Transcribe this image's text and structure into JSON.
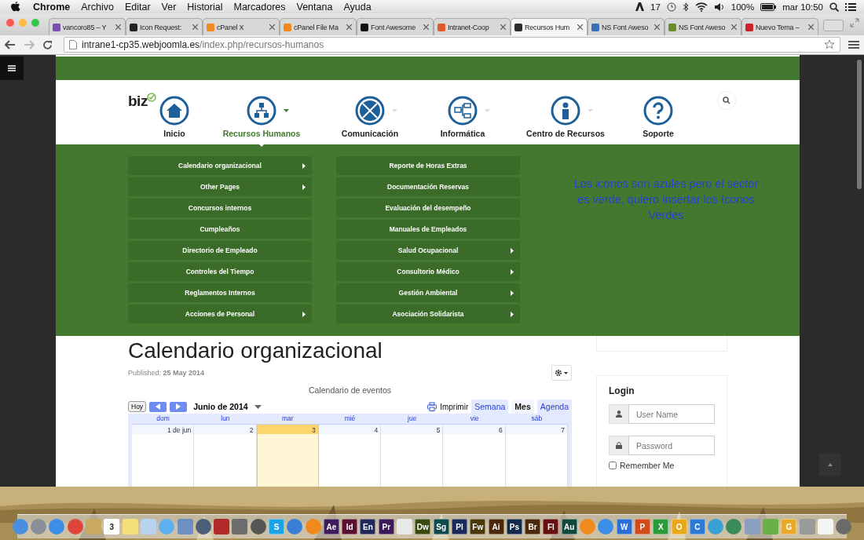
{
  "menubar": {
    "app": "Chrome",
    "items": [
      "Archivo",
      "Editar",
      "Ver",
      "Historial",
      "Marcadores",
      "Ventana",
      "Ayuda"
    ],
    "adobe_count": "17",
    "battery": "100%",
    "clock": "mar 10:50"
  },
  "tabs": [
    {
      "label": "vancoro85 – Y",
      "selected": false,
      "color": "#7b4fb0"
    },
    {
      "label": "Icon Request:",
      "selected": false,
      "color": "#222222"
    },
    {
      "label": "cPanel X",
      "selected": false,
      "color": "#f08a1c"
    },
    {
      "label": "cPanel File Ma",
      "selected": false,
      "color": "#f08a1c"
    },
    {
      "label": "Font Awesome",
      "selected": false,
      "color": "#111111"
    },
    {
      "label": "Intranet-Coop",
      "selected": false,
      "color": "#e05a2a"
    },
    {
      "label": "Recursos Hum",
      "selected": true,
      "color": "#2b2b2b"
    },
    {
      "label": "NS Font Aweso",
      "selected": false,
      "color": "#3b6fb6"
    },
    {
      "label": "NS Font Aweso",
      "selected": false,
      "color": "#6a8b2a"
    },
    {
      "label": "Nuevo Tema –",
      "selected": false,
      "color": "#d0202a"
    }
  ],
  "address": {
    "host": "intrane1-cp35.webjoomla.es",
    "path": "/index.php/recursos-humanos"
  },
  "site": {
    "logo": "biz",
    "nav": [
      {
        "label": "Inicio",
        "selected": false,
        "caret": false
      },
      {
        "label": "Recursos Humanos",
        "selected": true,
        "caret": true
      },
      {
        "label": "Comunicación",
        "selected": false,
        "caret": true
      },
      {
        "label": "Informática",
        "selected": false,
        "caret": true
      },
      {
        "label": "Centro de Recursos",
        "selected": false,
        "caret": true
      },
      {
        "label": "Soporte",
        "selected": false,
        "caret": false
      }
    ],
    "menu_left": [
      {
        "label": "Calendario organizacional",
        "submenu": true
      },
      {
        "label": "Other Pages",
        "submenu": true
      },
      {
        "label": "Concursos internos",
        "submenu": false
      },
      {
        "label": "Cumpleaños",
        "submenu": false
      },
      {
        "label": "Directorio de Empleado",
        "submenu": false
      },
      {
        "label": "Controles del Tiempo",
        "submenu": false
      },
      {
        "label": "Reglamentos Internos",
        "submenu": false
      },
      {
        "label": "Acciones de Personal",
        "submenu": true
      }
    ],
    "menu_right": [
      {
        "label": "Reporte de Horas Extras",
        "submenu": false
      },
      {
        "label": "Documentación Reservas",
        "submenu": false
      },
      {
        "label": "Evaluación del desempeño",
        "submenu": false
      },
      {
        "label": "Manuales de Empleados",
        "submenu": false
      },
      {
        "label": "Salud Ocupacional",
        "submenu": true
      },
      {
        "label": "Consultorio Médico",
        "submenu": true
      },
      {
        "label": "Gestión Ambiental",
        "submenu": true
      },
      {
        "label": "Asociación Solidarista",
        "submenu": true
      }
    ],
    "note": "Los iconos son azules pero el sector es verde, quiero insertar los Iconos Verdes",
    "title": "Calendario organizacional",
    "published": "Published: **25 May 2014**",
    "calendar": {
      "caption": "Calendario de eventos",
      "today_button": "Hoy",
      "month": "Junio de 2014",
      "print": "Imprimir",
      "views": [
        {
          "label": "Semana",
          "selected": false
        },
        {
          "label": "Mes",
          "selected": true
        },
        {
          "label": "Agenda",
          "selected": false
        }
      ],
      "days": [
        "dom",
        "lun",
        "mar",
        "mié",
        "jue",
        "vie",
        "sáb"
      ],
      "dates": [
        {
          "label": "1 de jun",
          "selected": false
        },
        {
          "label": "2",
          "selected": false
        },
        {
          "label": "3",
          "selected": true
        },
        {
          "label": "4",
          "selected": false
        },
        {
          "label": "5",
          "selected": false
        },
        {
          "label": "6",
          "selected": false
        },
        {
          "label": "7",
          "selected": false
        }
      ]
    },
    "login": {
      "title": "Login",
      "username": {
        "placeholder": "User Name"
      },
      "password": {
        "placeholder": "Password"
      },
      "remember": {
        "label": "Remember Me",
        "checked": false
      }
    }
  },
  "dock": [
    {
      "kind": "round",
      "color": "#4a8ee0"
    },
    {
      "kind": "round",
      "color": "#8a8f98"
    },
    {
      "kind": "round",
      "color": "#3a8ee6"
    },
    {
      "kind": "round",
      "color": "#e0453a"
    },
    {
      "kind": "square",
      "color": "#c9a860"
    },
    {
      "kind": "tile",
      "label": "3",
      "color": "#ffffff"
    },
    {
      "kind": "square",
      "color": "#f3e07a"
    },
    {
      "kind": "square",
      "color": "#b9d3ef"
    },
    {
      "kind": "round",
      "color": "#5fb0f0"
    },
    {
      "kind": "square",
      "color": "#6d8fc4"
    },
    {
      "kind": "round",
      "color": "#4c5f78"
    },
    {
      "kind": "square",
      "color": "#b02a2a"
    },
    {
      "kind": "square",
      "color": "#6d6d6d"
    },
    {
      "kind": "round",
      "color": "#555555"
    },
    {
      "kind": "tile",
      "label": "S",
      "color": "#1aa3e6"
    },
    {
      "kind": "round",
      "color": "#3a7fd6"
    },
    {
      "kind": "round",
      "color": "#f08a1c"
    },
    {
      "kind": "tile",
      "label": "Ae",
      "color": "#3d1c5a"
    },
    {
      "kind": "tile",
      "label": "Id",
      "color": "#5a0f33"
    },
    {
      "kind": "tile",
      "label": "En",
      "color": "#1f2a5a"
    },
    {
      "kind": "tile",
      "label": "Pr",
      "color": "#3c1a5a"
    },
    {
      "kind": "square",
      "color": "#e8e8e8"
    },
    {
      "kind": "tile",
      "label": "Dw",
      "color": "#3a4a0f"
    },
    {
      "kind": "tile",
      "label": "Sg",
      "color": "#0f4a4a"
    },
    {
      "kind": "tile",
      "label": "Pl",
      "color": "#1a2a5a"
    },
    {
      "kind": "tile",
      "label": "Fw",
      "color": "#4a3a0a"
    },
    {
      "kind": "tile",
      "label": "Ai",
      "color": "#4a2a0a"
    },
    {
      "kind": "tile",
      "label": "Ps",
      "color": "#0f2a4a"
    },
    {
      "kind": "tile",
      "label": "Br",
      "color": "#4a2a0a"
    },
    {
      "kind": "tile",
      "label": "Fl",
      "color": "#6a0f0f"
    },
    {
      "kind": "tile",
      "label": "Au",
      "color": "#0f4a3a"
    },
    {
      "kind": "round",
      "color": "#f08a1c"
    },
    {
      "kind": "round",
      "color": "#3a8ee6"
    },
    {
      "kind": "tile",
      "label": "W",
      "color": "#2a6fd6"
    },
    {
      "kind": "tile",
      "label": "P",
      "color": "#d04a1a"
    },
    {
      "kind": "tile",
      "label": "X",
      "color": "#2a9a3a"
    },
    {
      "kind": "tile",
      "label": "O",
      "color": "#e8a81a"
    },
    {
      "kind": "tile",
      "label": "C",
      "color": "#2a7ad6"
    },
    {
      "kind": "round",
      "color": "#3aa0d6"
    },
    {
      "kind": "round",
      "color": "#3a8a5a"
    },
    {
      "kind": "square",
      "color": "#8aa0c0"
    },
    {
      "kind": "square",
      "color": "#6ab04a"
    },
    {
      "kind": "tile",
      "label": "G",
      "color": "#e8a82a"
    },
    {
      "kind": "square",
      "color": "#9a9a9a"
    },
    {
      "kind": "square",
      "color": "#f4f4f4"
    },
    {
      "kind": "round",
      "color": "#6a6a6a"
    }
  ]
}
